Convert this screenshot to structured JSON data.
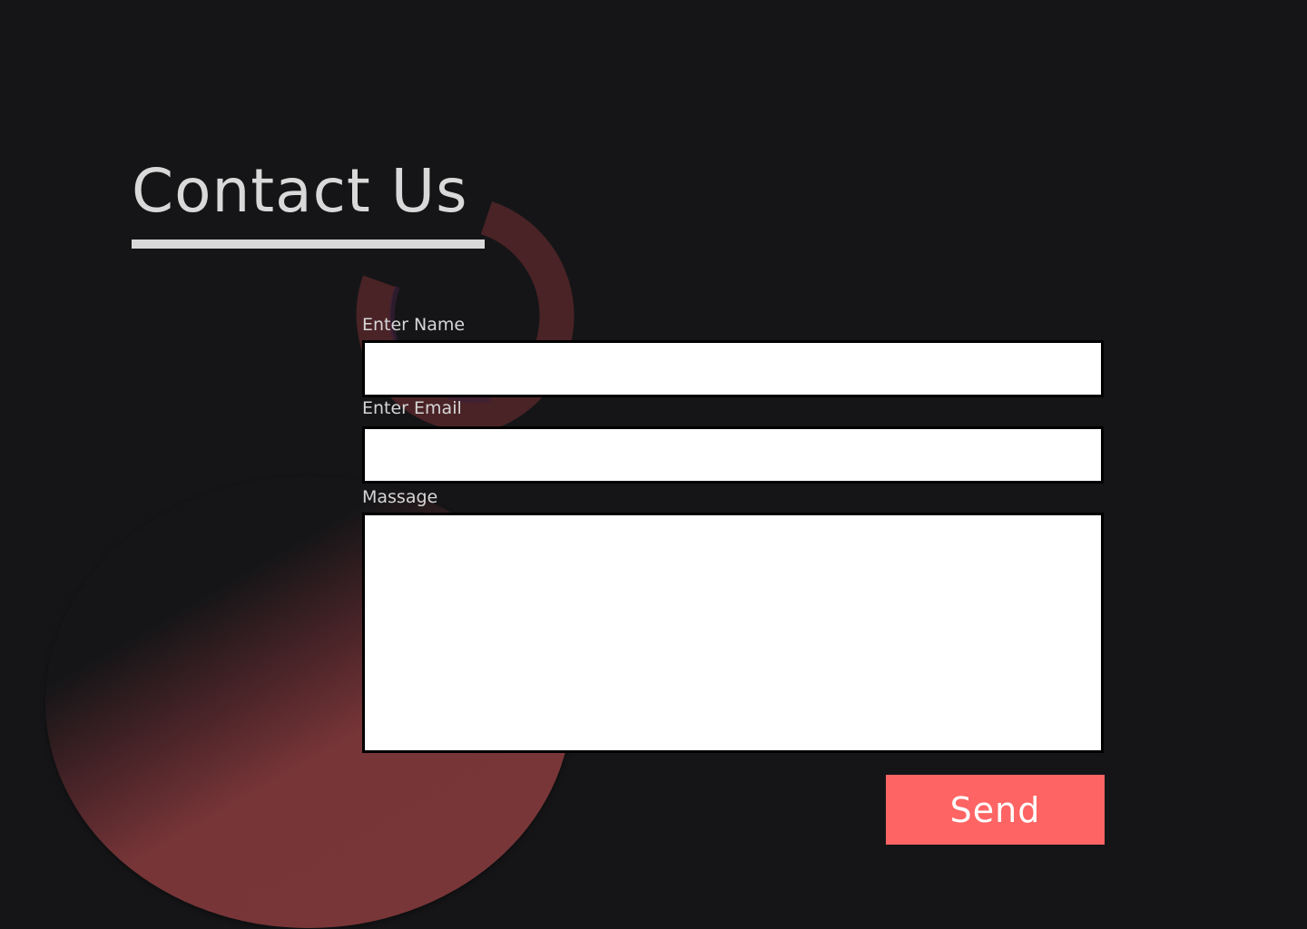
{
  "header": {
    "title": "Contact Us"
  },
  "form": {
    "name_label": "Enter Name",
    "name_value": "",
    "email_label": "Enter Email",
    "email_value": "",
    "message_label": "Massage",
    "message_value": "",
    "send_label": "Send"
  },
  "colors": {
    "background": "#151517",
    "title_text": "#d9d9d9",
    "accent_button": "#fe6464",
    "blob": "#7a3638",
    "ring": "#4a2326",
    "ring_inner": "#3a1f3a"
  }
}
